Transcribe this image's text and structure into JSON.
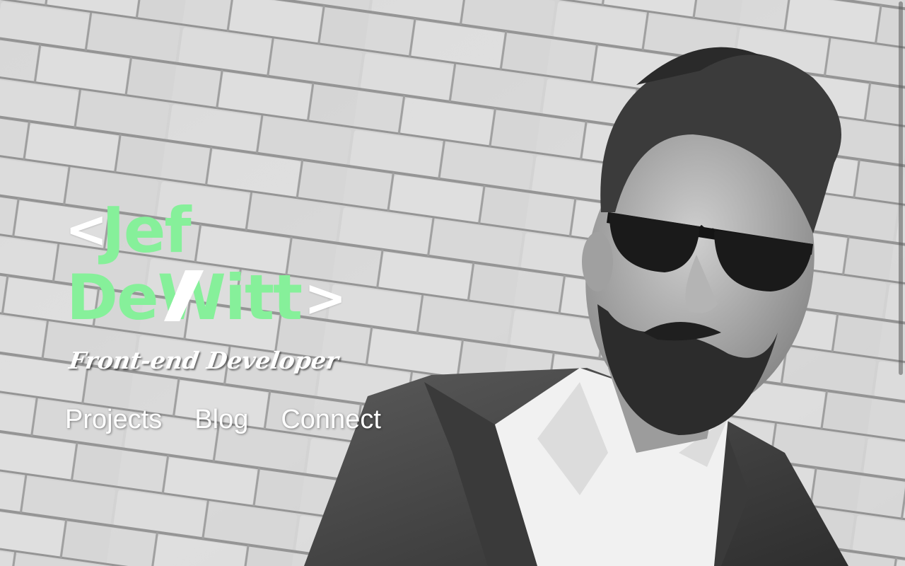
{
  "logo": {
    "bracket_open": "<",
    "first_name": "Jef",
    "last_name": "DeWitt",
    "bracket_close": ">"
  },
  "tagline": "Front-end Developer",
  "nav": {
    "items": [
      {
        "label": "Projects"
      },
      {
        "label": "Blog"
      },
      {
        "label": "Connect"
      }
    ]
  },
  "colors": {
    "accent": "#86f09a",
    "text": "#ffffff"
  }
}
